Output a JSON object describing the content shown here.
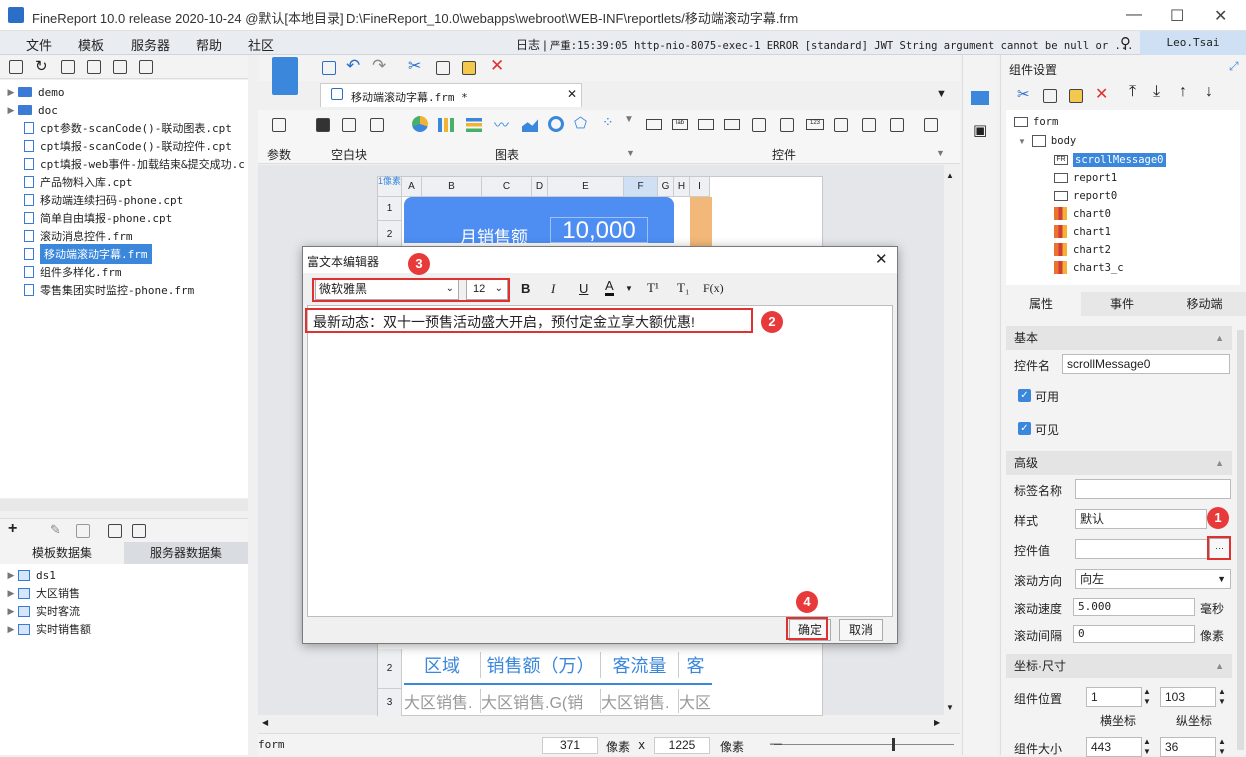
{
  "app": {
    "title": "FineReport 10.0 release 2020-10-24 @默认[本地目录]",
    "path": "D:\\FineReport_10.0\\webapps\\webroot\\WEB-INF\\reportlets/移动端滚动字幕.frm"
  },
  "menu": [
    "文件",
    "模板",
    "服务器",
    "帮助",
    "社区"
  ],
  "log": {
    "label": "日志",
    "text": "严重:15:39:05 http-nio-8075-exec-1 ERROR [standard] JWT String argument cannot be null or ..."
  },
  "user": "Leo.Tsai",
  "tree": [
    {
      "label": "demo",
      "type": "folder"
    },
    {
      "label": "doc",
      "type": "folder"
    },
    {
      "label": "cpt参数-scanCode()-联动图表.cpt",
      "type": "file"
    },
    {
      "label": "cpt填报-scanCode()-联动控件.cpt",
      "type": "file"
    },
    {
      "label": "cpt填报-web事件-加载结束&提交成功.c",
      "type": "file"
    },
    {
      "label": "产品物料入库.cpt",
      "type": "file"
    },
    {
      "label": "移动端连续扫码-phone.cpt",
      "type": "file"
    },
    {
      "label": "简单自由填报-phone.cpt",
      "type": "file"
    },
    {
      "label": "滚动消息控件.frm",
      "type": "file"
    },
    {
      "label": "移动端滚动字幕.frm",
      "type": "file",
      "selected": true
    },
    {
      "label": "组件多样化.frm",
      "type": "file"
    },
    {
      "label": "零售集团实时监控-phone.frm",
      "type": "file"
    }
  ],
  "datasets": {
    "tabs": [
      "模板数据集",
      "服务器数据集"
    ],
    "items": [
      "ds1",
      "大区销售",
      "实时客流",
      "实时销售额"
    ]
  },
  "tab_label": "移动端滚动字幕.frm *",
  "ribbon": {
    "groups": [
      "参数",
      "空白块",
      "图表",
      "控件"
    ]
  },
  "sheet": {
    "corner": "1像素",
    "cols": [
      "A",
      "B",
      "C",
      "D",
      "E",
      "F",
      "G",
      "H",
      "I"
    ],
    "rows": [
      "1",
      "2",
      "3"
    ],
    "card_label": "月销售额",
    "card_value": "10,000",
    "headers": [
      "区域",
      "销售额（万）",
      "客流量",
      "客"
    ],
    "cells": [
      "大区销售.",
      "大区销售.G(销",
      "大区销售.",
      "大区"
    ]
  },
  "status": {
    "left": "form",
    "x": "371",
    "x_unit": "像素",
    "times": "x",
    "y": "1225",
    "y_unit": "像素"
  },
  "right": {
    "title": "组件设置",
    "components": [
      "form",
      "body",
      "scrollMessage0",
      "report1",
      "report0",
      "chart0",
      "chart1",
      "chart2",
      "chart3_c"
    ],
    "tabs": [
      "属性",
      "事件",
      "移动端"
    ],
    "sections": {
      "basic": "基本",
      "advanced": "高级",
      "geometry": "坐标·尺寸"
    },
    "props": {
      "name_label": "控件名",
      "name_value": "scrollMessage0",
      "enabled": "可用",
      "visible": "可见",
      "tag_label": "标签名称",
      "tag_value": "",
      "style_label": "样式",
      "style_value": "默认",
      "value_label": "控件值",
      "value_value": "",
      "more": "···",
      "dir_label": "滚动方向",
      "dir_value": "向左",
      "speed_label": "滚动速度",
      "speed_value": "5.000",
      "speed_unit": "毫秒",
      "interval_label": "滚动间隔",
      "interval_value": "0",
      "interval_unit": "像素",
      "pos_label": "组件位置",
      "pos_x": "1",
      "pos_y": "103",
      "x_caption": "横坐标",
      "y_caption": "纵坐标",
      "size_label": "组件大小",
      "size_w": "443",
      "size_h": "36"
    }
  },
  "dialog": {
    "title": "富文本编辑器",
    "font": "微软雅黑",
    "size": "12",
    "toolbar": [
      "B",
      "I",
      "U",
      "A",
      "T¹",
      "T₁",
      "F(x)"
    ],
    "content": "最新动态：双十一预售活动盛大开启，预付定金立享大额优惠!",
    "ok": "确定",
    "cancel": "取消"
  },
  "badges": [
    "1",
    "2",
    "3",
    "4"
  ],
  "colors": {
    "accent": "#3a87dc",
    "card": "#4e8df2",
    "annotation": "#e03131"
  }
}
